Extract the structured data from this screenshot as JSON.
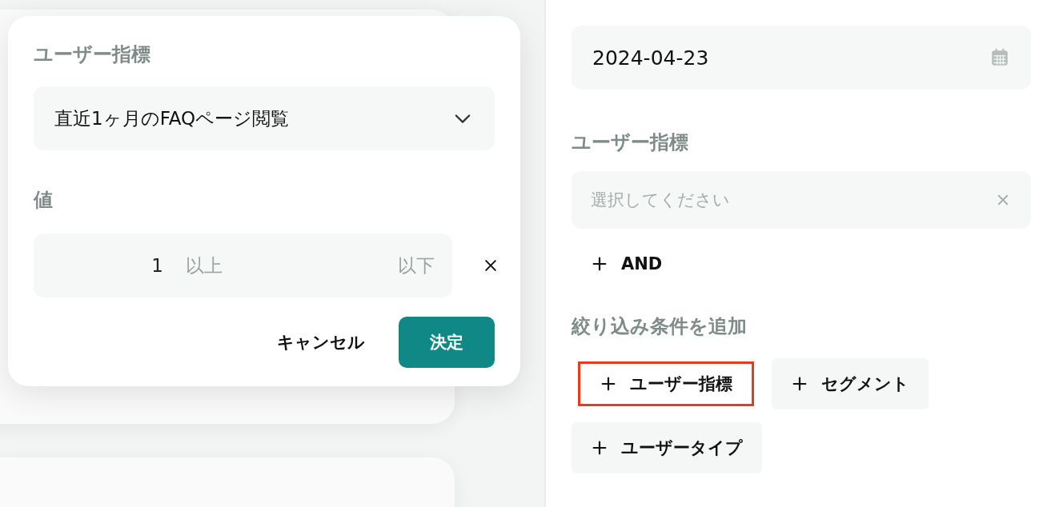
{
  "modal": {
    "metric_label": "ユーザー指標",
    "metric_select": {
      "value": "直近1ヶ月のFAQページ閲覧"
    },
    "value_label": "値",
    "range": {
      "min_value": "1",
      "min_placeholder": "以上",
      "max_placeholder": "以下"
    },
    "buttons": [
      {
        "label": "キャンセル",
        "kind": "text"
      },
      {
        "label": "決定",
        "kind": "primary"
      }
    ]
  },
  "panel": {
    "date_field": {
      "value": "2024-04-23"
    },
    "metric_label": "ユーザー指標",
    "metric_select": {
      "placeholder": "選択してください"
    },
    "and_button": {
      "label": "AND"
    },
    "add_filter_label": "絞り込み条件を追加",
    "add_buttons": [
      {
        "label": "ユーザー指標",
        "highlighted": true
      },
      {
        "label": "セグメント",
        "highlighted": false
      },
      {
        "label": "ユーザータイプ",
        "highlighted": false
      }
    ]
  }
}
